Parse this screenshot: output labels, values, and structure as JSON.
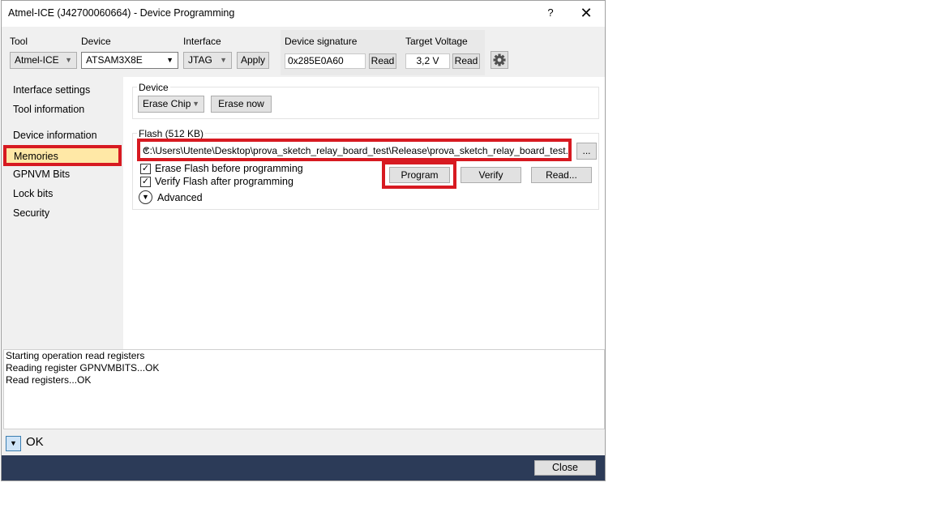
{
  "window": {
    "title": "Atmel-ICE (J42700060664) - Device Programming",
    "help": "?",
    "close": "✕"
  },
  "toolbar": {
    "tool_label": "Tool",
    "tool_value": "Atmel-ICE",
    "device_label": "Device",
    "device_value": "ATSAM3X8E",
    "interface_label": "Interface",
    "interface_value": "JTAG",
    "apply_label": "Apply",
    "signature_label": "Device signature",
    "signature_value": "0x285E0A60",
    "signature_read": "Read",
    "voltage_label": "Target Voltage",
    "voltage_value": "3,2 V",
    "voltage_read": "Read",
    "settings_icon": "gear-icon"
  },
  "sidebar": {
    "items": [
      {
        "label": "Interface settings"
      },
      {
        "label": "Tool information"
      },
      {
        "label": "Device information"
      },
      {
        "label": "Memories",
        "selected": true
      },
      {
        "label": "GPNVM Bits"
      },
      {
        "label": "Lock bits"
      },
      {
        "label": "Security"
      }
    ]
  },
  "device_group": {
    "title": "Device",
    "erase_mode": "Erase Chip",
    "erase_now": "Erase now"
  },
  "flash_group": {
    "title": "Flash (512 KB)",
    "path": "C:\\Users\\Utente\\Desktop\\prova_sketch_relay_board_test\\Release\\prova_sketch_relay_board_test.",
    "browse": "...",
    "erase_before": "Erase Flash before programming",
    "verify_after": "Verify Flash after programming",
    "program": "Program",
    "verify": "Verify",
    "read": "Read...",
    "advanced": "Advanced"
  },
  "log": {
    "lines": [
      "Starting operation read registers",
      "Reading register GPNVMBITS...OK",
      "Read registers...OK"
    ]
  },
  "status": {
    "text": "OK"
  },
  "footer": {
    "close": "Close"
  },
  "colors": {
    "highlight": "#d71a21",
    "selected_bg": "#ffe8a6",
    "footer_bg": "#2c3b58"
  }
}
